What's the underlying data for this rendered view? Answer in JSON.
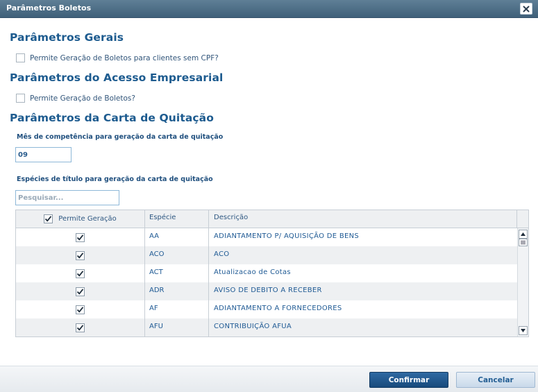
{
  "dialog": {
    "title": "Parâmetros Boletos",
    "close_icon": "close-icon"
  },
  "sections": {
    "gerais": {
      "title": "Parâmetros Gerais",
      "checkbox_label": "Permite Geração de Boletos para clientes sem CPF?",
      "checked": false
    },
    "acesso": {
      "title": "Parâmetros do Acesso Empresarial",
      "checkbox_label": "Permite Geração de Boletos?",
      "checked": false
    },
    "carta": {
      "title": "Parâmetros da Carta de Quitação",
      "month_label": "Mês de competência para geração da carta de quitação",
      "month_value": "09",
      "species_label": "Espécies de título para geração da carta de quitação",
      "search_placeholder": "Pesquisar..."
    }
  },
  "table": {
    "columns": [
      "Permite Geração",
      "Espécie",
      "Descrição"
    ],
    "header_checked": true,
    "rows": [
      {
        "checked": true,
        "especie": "AA",
        "descricao": "ADIANTAMENTO P/ AQUISIÇÃO DE BENS"
      },
      {
        "checked": true,
        "especie": "ACO",
        "descricao": "ACO"
      },
      {
        "checked": true,
        "especie": "ACT",
        "descricao": "Atualizacao de Cotas"
      },
      {
        "checked": true,
        "especie": "ADR",
        "descricao": "AVISO DE DEBITO A RECEBER"
      },
      {
        "checked": true,
        "especie": "AF",
        "descricao": "ADIANTAMENTO A FORNECEDORES"
      },
      {
        "checked": true,
        "especie": "AFU",
        "descricao": "CONTRIBUIÇÃO AFUA"
      }
    ]
  },
  "footer": {
    "confirm_label": "Confirmar",
    "cancel_label": "Cancelar"
  },
  "colors": {
    "accent": "#1d5b8f",
    "titlebar": "#4a6a83",
    "confirm_button": "#1f5589"
  }
}
